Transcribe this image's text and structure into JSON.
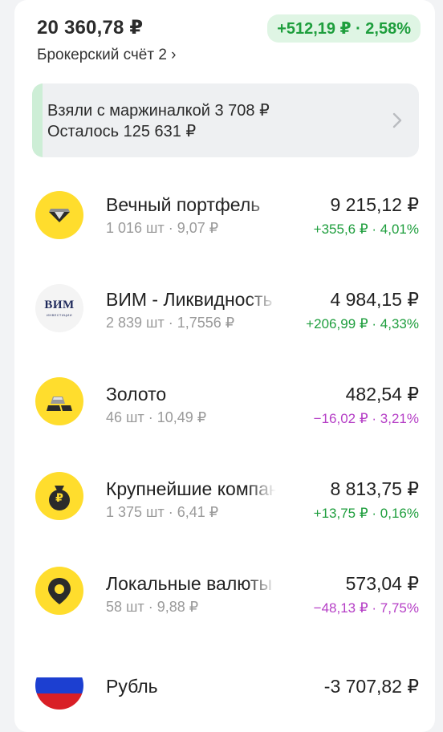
{
  "header": {
    "total": "20 360,78 ₽",
    "change": "+512,19 ₽ · 2,58%",
    "account": "Брокерский счёт 2 ›"
  },
  "margin": {
    "line1": "Взяли с маржиналкой 3 708 ₽",
    "line2": "Осталось 125 631 ₽"
  },
  "holdings": [
    {
      "name": "Вечный портфель",
      "sub": "1 016 шт · 9,07 ₽",
      "value": "9 215,12 ₽",
      "delta": "+355,6 ₽ · 4,01%",
      "icon": "diamond-icon"
    },
    {
      "name": "ВИМ - Ликвидность",
      "sub": "2 839 шт · 1,7556 ₽",
      "value": "4 984,15 ₽",
      "delta": "+206,99 ₽ · 4,33%",
      "icon": "vim-logo",
      "logo_text": "ВИМ",
      "logo_sub": "ИНВЕСТИЦИИ"
    },
    {
      "name": "Золото",
      "sub": "46 шт · 10,49 ₽",
      "value": "482,54 ₽",
      "delta": "−16,02 ₽ · 3,21%",
      "icon": "gold-bar-icon"
    },
    {
      "name": "Крупнейшие компании",
      "sub": "1 375 шт · 6,41 ₽",
      "value": "8 813,75 ₽",
      "delta": "+13,75 ₽ · 0,16%",
      "icon": "money-bag-icon",
      "icon_glyph": "₽"
    },
    {
      "name": "Локальные валюты",
      "sub": "58 шт · 9,88 ₽",
      "value": "573,04 ₽",
      "delta": "−48,13 ₽ · 7,75%",
      "icon": "map-pin-icon"
    },
    {
      "name": "Рубль",
      "value": "-3 707,82 ₽",
      "icon": "russia-flag-icon"
    }
  ],
  "colors": {
    "positive": "#1e9e3d",
    "negative": "#b53ec6",
    "accent_yellow": "#ffdd2d",
    "pill_bg": "#dff5e4"
  }
}
